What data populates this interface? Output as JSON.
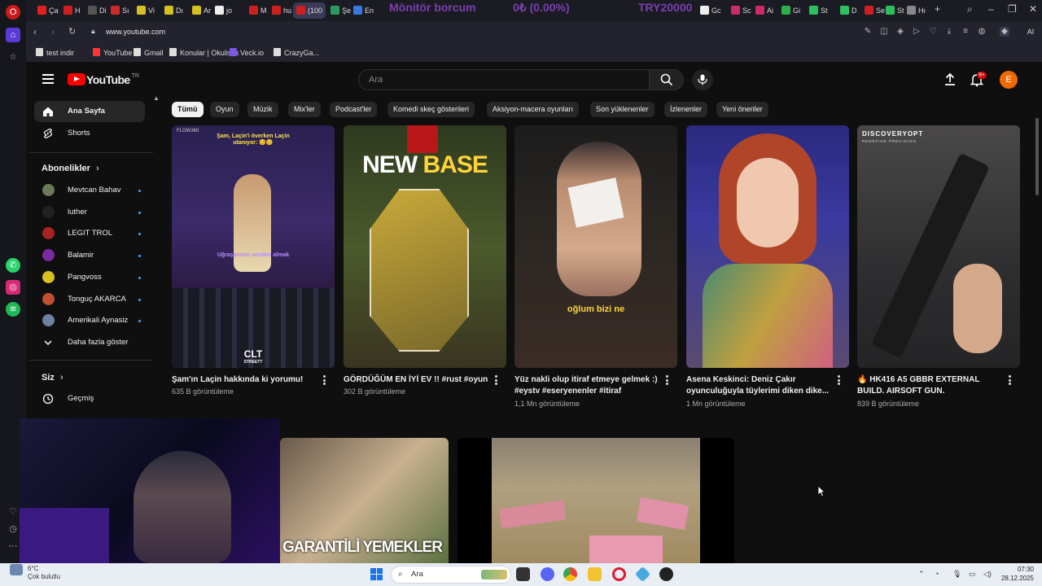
{
  "browser": {
    "tabs": [
      "Ça",
      "H",
      "Di",
      "Sı",
      "Vi",
      "Dı",
      "Ar",
      "jo",
      "M",
      "hu",
      "(100",
      "Şe",
      "En",
      "Gc",
      "Sc",
      "Ai",
      "Gi",
      "St",
      "D",
      "Se",
      "St",
      "Hı"
    ],
    "tab_overlay": {
      "left": "Mönitör borcum",
      "middle": "0₺ (0.00%)",
      "right": "TRY20000"
    },
    "url": "www.youtube.com",
    "address_right_label": "AI",
    "bookmarks": [
      "test indir",
      "YouTube",
      "Gmail",
      "Konular | Okulistik",
      "Veck.io",
      "CrazyGa..."
    ]
  },
  "youtube": {
    "logo_word": "YouTube",
    "logo_region": "TR",
    "search_placeholder": "Ara",
    "notif_badge": "9+",
    "avatar_letter": "E",
    "sidebar": {
      "nav": [
        {
          "label": "Ana Sayfa",
          "icon": "home-icon",
          "active": true
        },
        {
          "label": "Shorts",
          "icon": "shorts-icon",
          "active": false
        }
      ],
      "subscriptions_title": "Abonelikler",
      "subscriptions": [
        {
          "name": "Mevtcan Bahav",
          "color": "#6a7a5a"
        },
        {
          "name": "luther",
          "color": "#222222"
        },
        {
          "name": "LEGIT TROL",
          "color": "#aa2222"
        },
        {
          "name": "Balamir",
          "color": "#7a2aa0"
        },
        {
          "name": "Pangvoss",
          "color": "#d8c020"
        },
        {
          "name": "Tonguç AKARCA",
          "color": "#c05030"
        },
        {
          "name": "Amerikali Aynasiz",
          "color": "#7080a0"
        }
      ],
      "show_more": "Daha fazla göster",
      "you_title": "Siz",
      "history": "Geçmiş"
    },
    "chips": [
      "Tümü",
      "Oyun",
      "Müzik",
      "Mix'ler",
      "Podcast'ler",
      "Komedi skeç gösterileri",
      "Aksiyon-macera oyunları",
      "Son yüklenenler",
      "İzlenenler",
      "Yeni öneriler"
    ],
    "videos": [
      {
        "title": "Şam'ın Laçin hakkında ki yorumu!",
        "views": "635 B görüntüleme",
        "thumb_caption": "Şam, Laçin'i överken Laçin utanıyor: 😊😊",
        "thumb_mid": "Uğraşamam senden almak",
        "thumb_logo": "CLT",
        "thumb_logo_sub": "STREETT",
        "corner": "FLOW360"
      },
      {
        "title": "GÖRDÜĞÜM EN İYİ EV !! #rust #oyun",
        "views": "302 B görüntüleme",
        "thumb_caption": "NEW BASE",
        "thumb_word1": "NEW",
        "thumb_word2": "BASE"
      },
      {
        "title_line1": "Yüz nakli olup itiraf etmeye gelmek :)",
        "title_line2": "#eystv #eseryenenler #itiraf",
        "views": "1,1 Mn görüntüleme",
        "thumb_caption": "oğlum bizi ne"
      },
      {
        "title_line1": "Asena Keskinci: Deniz Çakır",
        "title_line2": "oyunculuğuyla tüylerimi diken dike...",
        "views": "1 Mn görüntüleme"
      },
      {
        "title_line1": "🔥 HK416 A5  GBBR EXTERNAL",
        "title_line2": "BUILD.  AIRSOFT GUN.",
        "views": "839 B görüntüleme",
        "thumb_caption": "DISCOVERYOPT",
        "thumb_sub": "REDEFINE PRECISION"
      }
    ],
    "row2_caption": "GARANTİLİ YEMEKLER"
  },
  "taskbar": {
    "temp": "6°C",
    "weather": "Çok bulutlu",
    "search_placeholder": "Ara",
    "time": "07:30",
    "date": "28.12.2025"
  },
  "colors": {
    "yt_bg": "#0f0f0f",
    "yt_red": "#ff0000",
    "chip_bg": "#272727",
    "avatar": "#f06a00"
  }
}
